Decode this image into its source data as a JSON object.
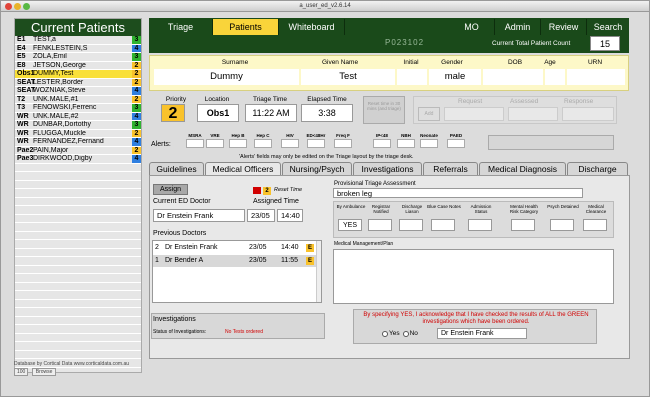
{
  "window_title": "a_user_ed_v2.6.14",
  "left_panel": {
    "title": "Current Patients",
    "patients": [
      {
        "bed": "E1",
        "name": "TEST,a",
        "triage": "3",
        "bg": "#e6e6e6",
        "tri_color": "#2fb32f"
      },
      {
        "bed": "E4",
        "name": "FENKLESTEIN,S",
        "triage": "4",
        "bg": "#e6e6e6",
        "tri_color": "#2f7fe0"
      },
      {
        "bed": "E5",
        "name": "ZOLA,Emil",
        "triage": "3",
        "bg": "#e6e6e6",
        "tri_color": "#2fb32f"
      },
      {
        "bed": "E8",
        "name": "JETSON,George",
        "triage": "2",
        "bg": "#e6e6e6",
        "tri_color": "#f9c22b"
      },
      {
        "bed": "Obs1",
        "name": "DUMMY,Test",
        "triage": "2",
        "bg": "#f9e03a",
        "tri_color": "#f9c22b"
      },
      {
        "bed": "SEAT",
        "name": "LESTER,Border",
        "triage": "2",
        "bg": "#e6e6e6",
        "tri_color": "#f9c22b"
      },
      {
        "bed": "SEAT",
        "name": "WOZNIAK,Steve",
        "triage": "4",
        "bg": "#e6e6e6",
        "tri_color": "#2f7fe0"
      },
      {
        "bed": "T2",
        "name": "UNK.MALE,#1",
        "triage": "2",
        "bg": "#e6e6e6",
        "tri_color": "#f9c22b"
      },
      {
        "bed": "T3",
        "name": "FENOWSKI,Ferrenc",
        "triage": "3",
        "bg": "#e6e6e6",
        "tri_color": "#2fb32f"
      },
      {
        "bed": "WR",
        "name": "UNK.MALE,#2",
        "triage": "4",
        "bg": "#e6e6e6",
        "tri_color": "#2f7fe0"
      },
      {
        "bed": "WR",
        "name": "DUNBAR,Dortothy",
        "triage": "3",
        "bg": "#e6e6e6",
        "tri_color": "#2fb32f"
      },
      {
        "bed": "WR",
        "name": "FLUGGA,Muckle",
        "triage": "2",
        "bg": "#e6e6e6",
        "tri_color": "#f9c22b"
      },
      {
        "bed": "WR",
        "name": "FERNANDEZ,Fernand",
        "triage": "4",
        "bg": "#e6e6e6",
        "tri_color": "#2f7fe0"
      },
      {
        "bed": "Pae2",
        "name": "PAIN,Major",
        "triage": "2",
        "bg": "#e6e6e6",
        "tri_color": "#f9c22b"
      },
      {
        "bed": "Pae3",
        "name": "DIRKWOOD,Digby",
        "triage": "4",
        "bg": "#e6e6e6",
        "tri_color": "#2f7fe0"
      }
    ],
    "footer_line1": "Database by Cortical Data  www.corticaldata.com.au",
    "footer_zoom": "100",
    "footer_mode": "Browse"
  },
  "nav": {
    "items": [
      "Triage",
      "Patients",
      "Whiteboard",
      "MO",
      "Admin",
      "Review",
      "Search"
    ],
    "active": "Patients",
    "patient_id": "P023102",
    "total_label": "Current Total Patient Count",
    "total_value": "15"
  },
  "banner": {
    "headers": {
      "surname": "Surname",
      "given": "Given Name",
      "initial": "Initial",
      "gender": "Gender",
      "dob": "DOB",
      "age": "Age",
      "urn": "URN"
    },
    "values": {
      "surname": "Dummy",
      "given": "Test",
      "initial": "",
      "gender": "male",
      "dob": "",
      "age": "",
      "urn": ""
    }
  },
  "triage": {
    "priority_label": "Priority",
    "priority": "2",
    "location_label": "Location",
    "location": "Obs1",
    "triage_time_label": "Triage Time",
    "triage_time": "11:22 AM",
    "elapsed_label": "Elapsed Time",
    "elapsed": "3:38",
    "reset_hint": "Reset time in 30 mins (and triage)",
    "request_label": "Request",
    "assessed_label": "Assessed",
    "response_label": "Response",
    "mini_btn": "Add"
  },
  "alerts": {
    "label": "Alerts:",
    "columns": [
      "MSRA",
      "VRE",
      "Hep B",
      "Hep C",
      "HIV",
      "ED<48Hr",
      "Freq F",
      "IP<48",
      "NBH",
      "Neonate",
      "PAED"
    ],
    "note": "'Alerts' fields may only be edited on the Triage layout by the triage desk."
  },
  "tabs": [
    "Guidelines",
    "Medical Officers",
    "Nursing/Psych",
    "Investigations",
    "Referrals",
    "Medical Diagnosis",
    "Discharge"
  ],
  "active_tab": "Medical Officers",
  "mo_tab": {
    "assign_btn": "Assign",
    "reset_badge": "2",
    "reset_label": "Reset Time",
    "current_doctor_label": "Current ED Doctor",
    "assigned_time_label": "Assigned Time",
    "current_doctor": "Dr Enstein Frank",
    "assigned_date": "23/05",
    "assigned_time": "14:40",
    "previous_label": "Previous Doctors",
    "previous": [
      {
        "num": "2",
        "name": "Dr Enstein Frank",
        "date": "23/05",
        "time": "14:40",
        "flag": "E"
      },
      {
        "num": "1",
        "name": "Dr Bender A",
        "date": "23/05",
        "time": "11:55",
        "flag": "E"
      }
    ],
    "provisional_label": "Provisional Triage Assessment",
    "provisional_value": "broken leg",
    "status_cols": [
      "By Ambulance",
      "Registrar Notified",
      "Discharge Liason",
      "Blue Case Notes",
      "Admission Status",
      "Mental Health Risk Category",
      "Psych Detained",
      "Medical Clearance"
    ],
    "by_ambulance": "YES",
    "mgmt_label": "Medical Management/Plan",
    "investigations_label": "Investigations",
    "status_inv_label": "Status of Investigations:",
    "status_inv_value": "No Tests ordered",
    "ack_text": "By specifying YES, I acknowledge that I have checked the results of ALL the GREEN investigations which have been ordered.",
    "yes_label": "Yes",
    "no_label": "No",
    "ack_doctor": "Dr Enstein Frank"
  }
}
